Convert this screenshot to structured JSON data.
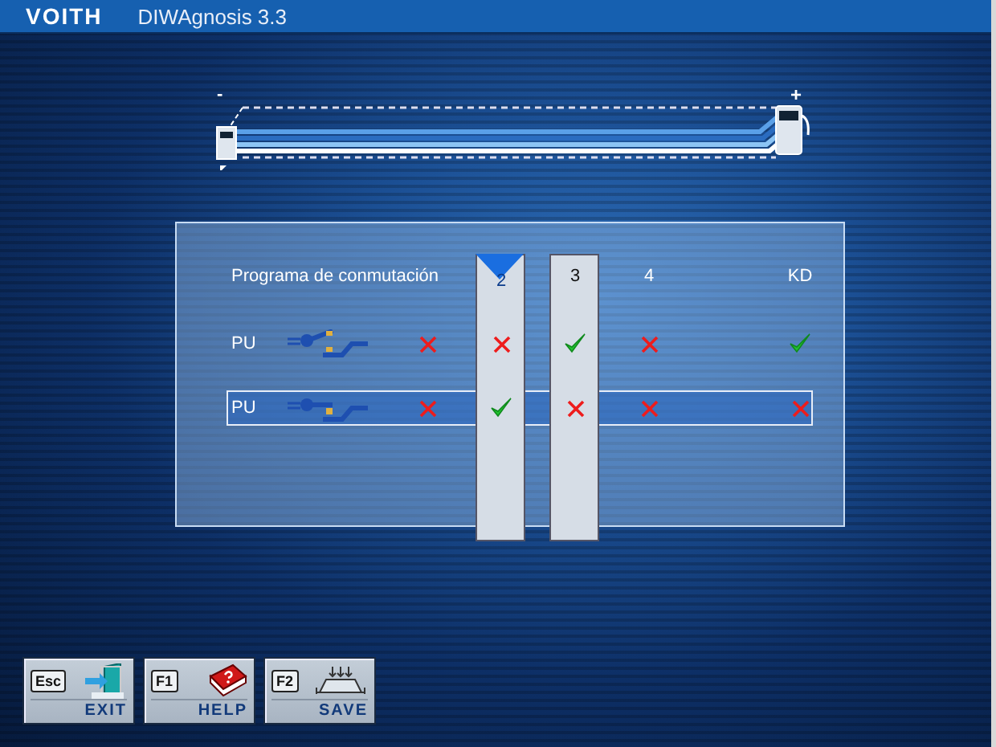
{
  "window": {
    "brand": "VOITH",
    "title": "DIWAgnosis 3.3"
  },
  "gauge": {
    "min_label": "-",
    "max_label": "+"
  },
  "table": {
    "title": "Programa de conmutación",
    "columns": [
      {
        "label": "2",
        "selected": true,
        "marked": true
      },
      {
        "label": "3",
        "selected": false,
        "marked": true
      },
      {
        "label": "4",
        "selected": false,
        "marked": false
      },
      {
        "label": "KD",
        "selected": false,
        "marked": false
      }
    ],
    "rows": [
      {
        "label": "PU",
        "kind": "up",
        "selected": false,
        "marks": [
          false,
          false,
          true,
          false,
          true
        ]
      },
      {
        "label": "PU",
        "kind": "down",
        "selected": true,
        "marks": [
          false,
          true,
          false,
          false,
          false
        ]
      }
    ]
  },
  "buttons": [
    {
      "key": "Esc",
      "label": "EXIT",
      "kind": "exit"
    },
    {
      "key": "F1",
      "label": "HELP",
      "kind": "help"
    },
    {
      "key": "F2",
      "label": "SAVE",
      "kind": "save"
    }
  ]
}
